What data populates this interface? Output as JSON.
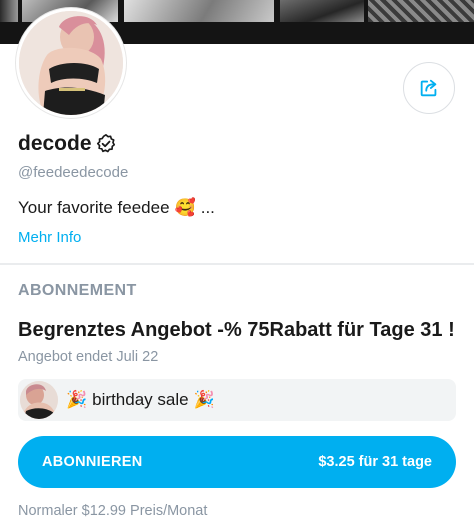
{
  "profile": {
    "name": "decode",
    "handle": "@feedeedecode",
    "bio": "Your favorite feedee",
    "bio_emoji": "🥰",
    "bio_suffix": "...",
    "more_info": "Mehr Info",
    "verified_icon": "verified-badge-icon",
    "share_icon": "share-icon"
  },
  "subscription": {
    "section_title": "ABONNEMENT",
    "offer_title": "Begrenztes Angebot -% 75Rabatt für Tage 31 !",
    "offer_ends": "Angebot endet Juli 22",
    "promo_emoji_left": "🎉",
    "promo_text": "birthday sale",
    "promo_emoji_right": "🎉",
    "button_label": "ABONNIEREN",
    "button_price": "$3.25 für 31 tage",
    "regular_price": "Normaler $12.99 Preis/Monat"
  },
  "colors": {
    "accent": "#00aff0",
    "muted": "#8a96a3",
    "text": "#1a1a1a",
    "promo_bg": "#f2f4f5"
  }
}
